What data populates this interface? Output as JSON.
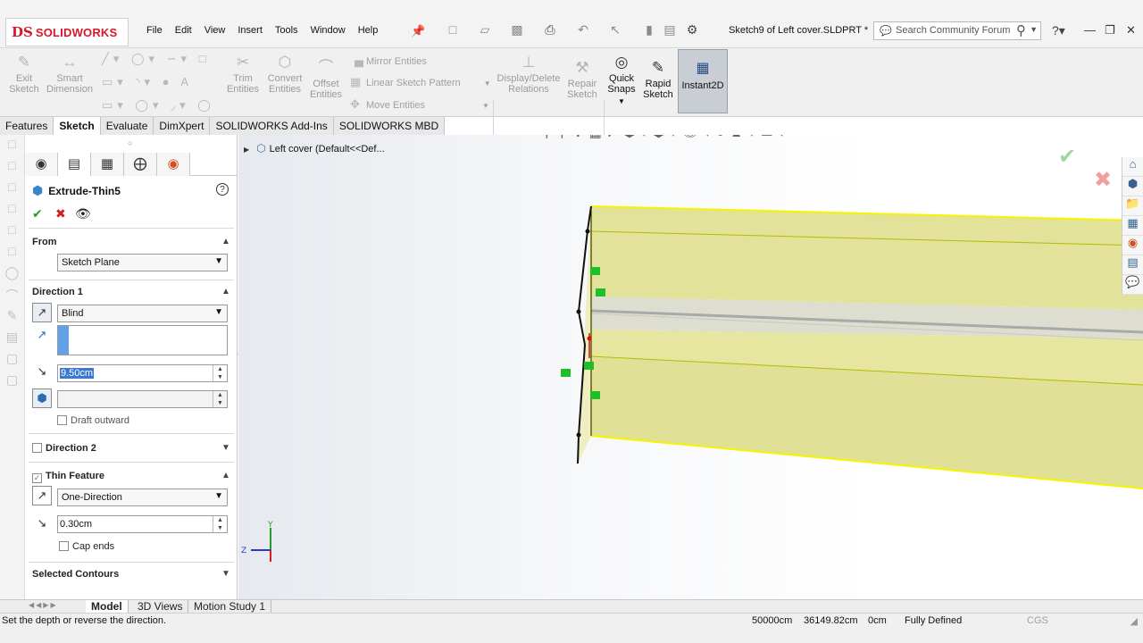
{
  "app": {
    "logo_mark": "DS",
    "logo_text": "SOLIDWORKS",
    "document_title": "Sketch9 of Left cover.SLDPRT *"
  },
  "menu": [
    "File",
    "Edit",
    "View",
    "Insert",
    "Tools",
    "Window",
    "Help"
  ],
  "search": {
    "placeholder": "Search Community Forum"
  },
  "ribbon": {
    "exit_sketch": "Exit\nSketch",
    "smart_dimension": "Smart\nDimension",
    "trim_entities": "Trim\nEntities",
    "convert_entities": "Convert\nEntities",
    "offset_entities": "Offset\nEntities",
    "mirror_entities": "Mirror Entities",
    "linear_sketch_pattern": "Linear Sketch Pattern",
    "move_entities": "Move Entities",
    "display_delete_relations": "Display/Delete\nRelations",
    "repair_sketch": "Repair\nSketch",
    "quick_snaps": "Quick\nSnaps",
    "rapid_sketch": "Rapid\nSketch",
    "instant2d": "Instant2D"
  },
  "tabs": [
    "Features",
    "Sketch",
    "Evaluate",
    "DimXpert",
    "SOLIDWORKS Add-Ins",
    "SOLIDWORKS MBD"
  ],
  "active_tab": "Sketch",
  "property_manager": {
    "title": "Extrude-Thin5",
    "from": {
      "label": "From",
      "value": "Sketch Plane"
    },
    "direction1": {
      "label": "Direction 1",
      "end_condition": "Blind",
      "depth": "9.50cm",
      "draft_outward": "Draft outward"
    },
    "direction2": {
      "label": "Direction 2"
    },
    "thin_feature": {
      "label": "Thin Feature",
      "type": "One-Direction",
      "thickness": "0.30cm",
      "cap_ends": "Cap ends"
    },
    "selected_contours": {
      "label": "Selected Contours"
    }
  },
  "viewport": {
    "tree_node": "Left cover  (Default<<Def...",
    "triad": {
      "x": "Z",
      "y": "Y"
    }
  },
  "bottom_tabs": [
    "Model",
    "3D Views",
    "Motion Study 1"
  ],
  "status": {
    "message": "Set the depth or reverse the direction.",
    "x": "50000cm",
    "y": "36149.82cm",
    "z": "0cm",
    "state": "Fully Defined",
    "units": "CGS"
  },
  "colors": {
    "brand": "#d6192a",
    "model_face": "#e2e29a",
    "model_edge": "#f5f500",
    "highlight": "#c9cdd4"
  }
}
